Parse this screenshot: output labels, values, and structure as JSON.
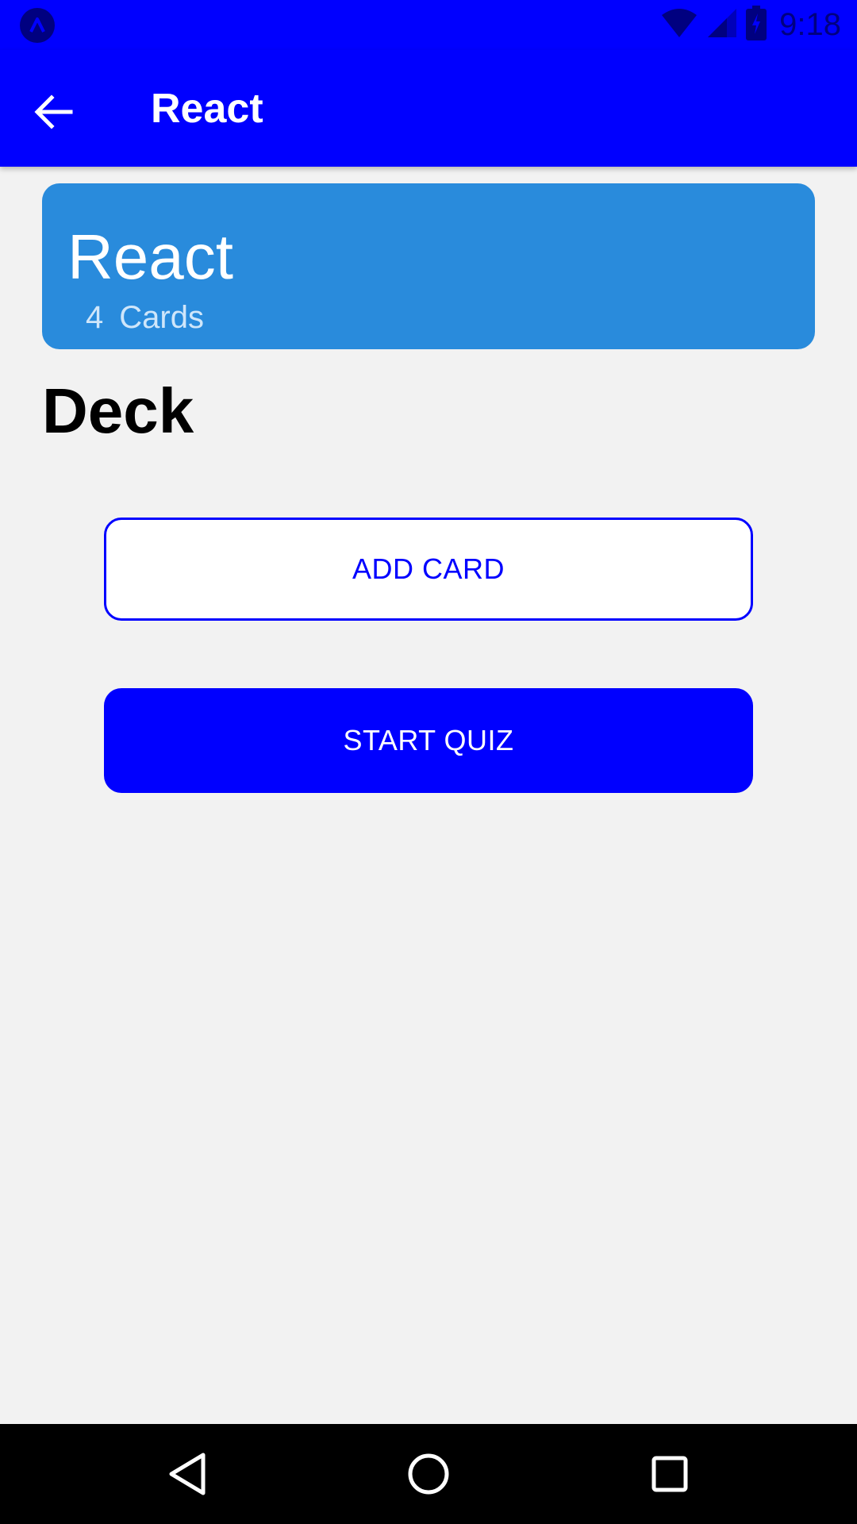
{
  "status_bar": {
    "time": "9:18",
    "icons": [
      "app-notification-icon",
      "wifi-icon",
      "signal-icon",
      "battery-charging-icon"
    ],
    "background_color": "#0000ff",
    "icon_color": "#000080"
  },
  "app_bar": {
    "title": "React",
    "back_icon": "arrow-left-icon",
    "background_color": "#0000ff"
  },
  "deck": {
    "title": "React",
    "card_count": "4",
    "card_count_label": "Cards",
    "background_color": "#298bdc"
  },
  "section": {
    "heading": "Deck"
  },
  "actions": {
    "add_card_label": "ADD CARD",
    "start_quiz_label": "START QUIZ",
    "accent_color": "#0000ff"
  },
  "nav_bar": {
    "icons": [
      "back-triangle-icon",
      "home-circle-icon",
      "recents-square-icon"
    ]
  }
}
